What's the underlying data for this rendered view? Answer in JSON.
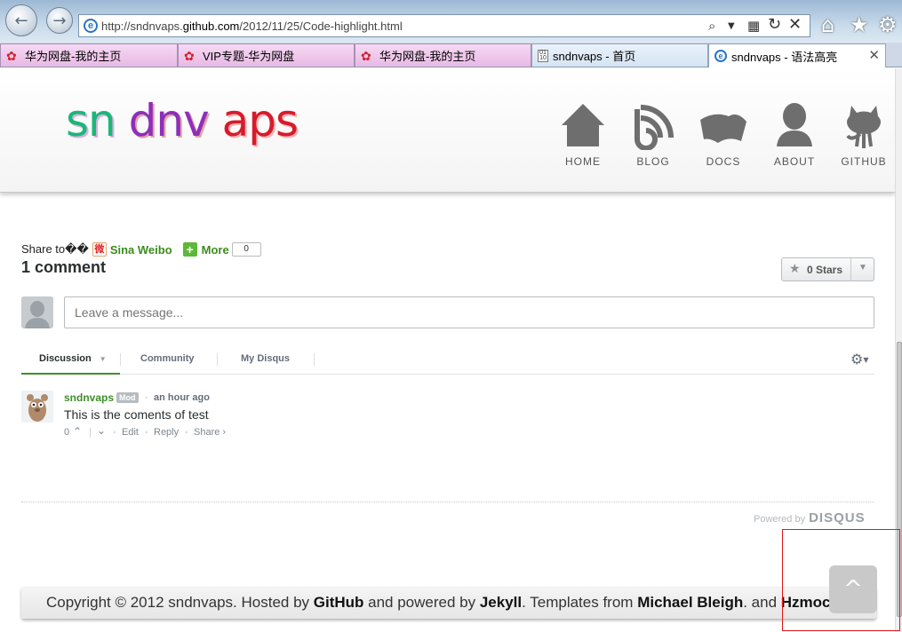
{
  "browser": {
    "url_prefix": "http://sndnvaps.",
    "url_host": "github.com",
    "url_path": "/2012/11/25/Code-highlight.html",
    "tabs": [
      {
        "label": "华为网盘-我的主页"
      },
      {
        "label": "VIP专题-华为网盘"
      },
      {
        "label": "华为网盘-我的主页"
      },
      {
        "label": "sndnvaps - 首页"
      },
      {
        "label": "sndnvaps - 语法高亮"
      }
    ]
  },
  "site": {
    "logo_parts": [
      "sn",
      "dnv",
      "aps"
    ],
    "nav": [
      {
        "label": "HOME",
        "icon": "home-icon"
      },
      {
        "label": "BLOG",
        "icon": "rss-icon"
      },
      {
        "label": "DOCS",
        "icon": "docs-icon"
      },
      {
        "label": "ABOUT",
        "icon": "person-icon"
      },
      {
        "label": "GITHUB",
        "icon": "octocat-icon"
      }
    ]
  },
  "share": {
    "prefix": "Share to��",
    "weibo": "Sina Weibo",
    "more": "More",
    "count": "0"
  },
  "comments": {
    "count_label": "1 comment",
    "stars_label": "0 Stars",
    "input_placeholder": "Leave a message...",
    "tabs": [
      "Discussion",
      "Community",
      "My Disqus"
    ],
    "posts": [
      {
        "author": "sndnvaps",
        "badge": "Mod",
        "time": "an hour ago",
        "body": "This is the coments of test",
        "votes": "0",
        "edit": "Edit",
        "reply": "Reply",
        "share": "Share ›"
      }
    ],
    "powered_by": "Powered by",
    "powered_brand": "DISQUS"
  },
  "footer": {
    "t1": "Copyright © 2012 sndnvaps. Hosted by ",
    "b1": "GitHub",
    "t2": " and powered by ",
    "b2": "Jekyll",
    "t3": ". Templates from ",
    "b3": "Michael Bleigh",
    "t4": ". and ",
    "b4": "Hzmoc"
  },
  "to_top_label": "^",
  "colors": {
    "accent_green": "#3e8f2a",
    "highlight_red": "#e01818"
  }
}
